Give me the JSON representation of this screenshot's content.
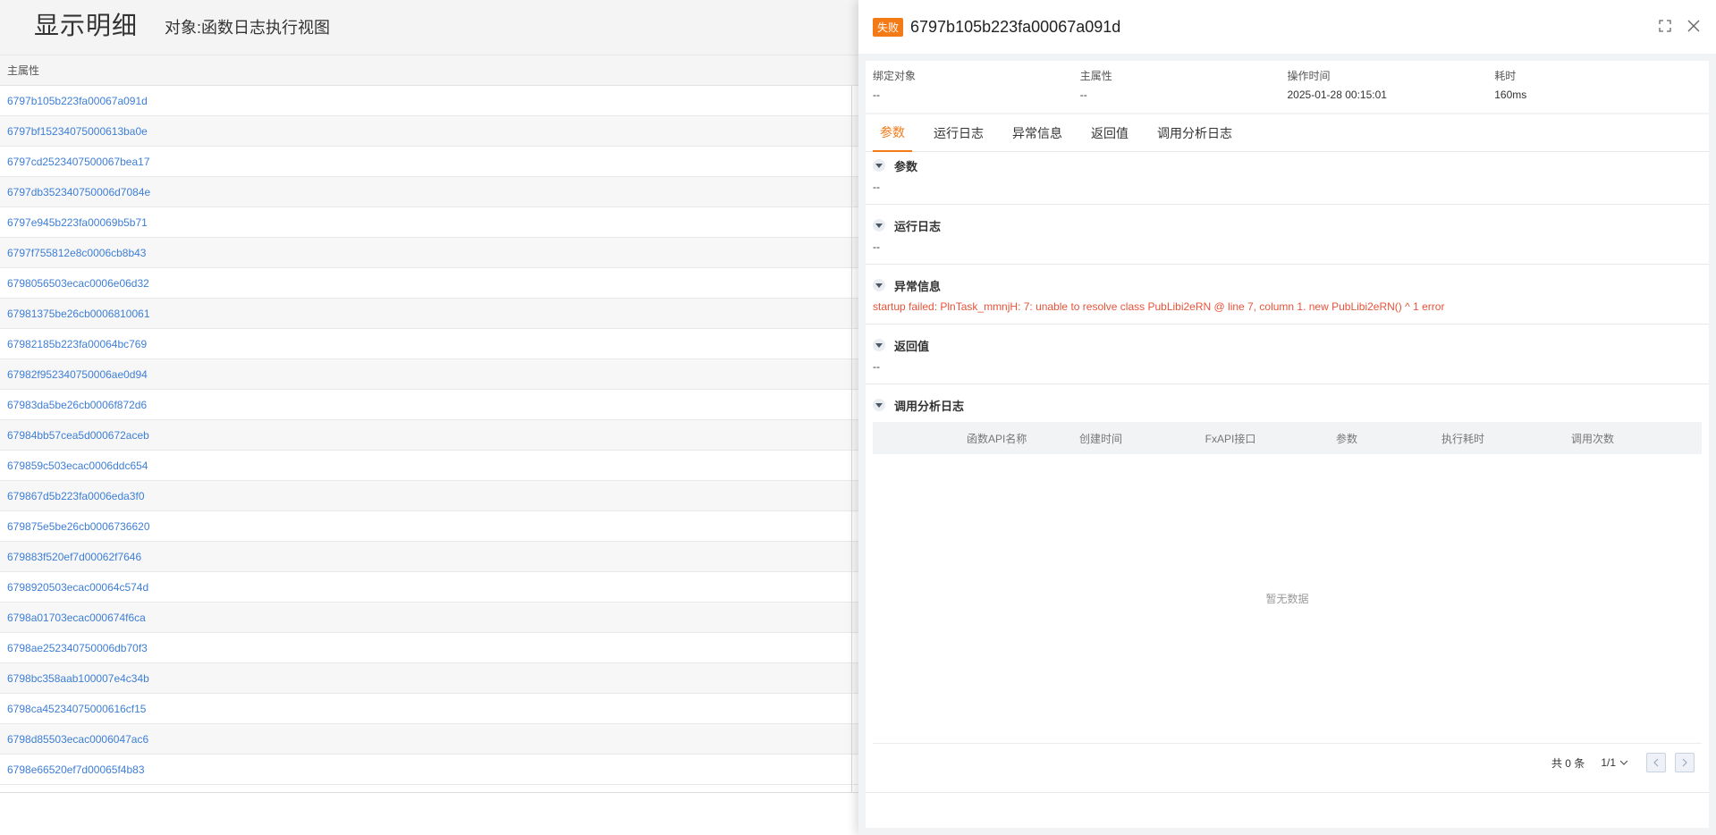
{
  "left": {
    "title": "显示明细",
    "subtitle": "对象:函数日志执行视图",
    "column_header": "主属性",
    "rows": [
      "6797b105b223fa00067a091d",
      "6797bf15234075000613ba0e",
      "6797cd2523407500067bea17",
      "6797db352340750006d7084e",
      "6797e945b223fa00069b5b71",
      "6797f755812e8c0006cb8b43",
      "6798056503ecac0006e06d32",
      "67981375be26cb0006810061",
      "67982185b223fa00064bc769",
      "67982f952340750006ae0d94",
      "67983da5be26cb0006f872d6",
      "67984bb57cea5d000672aceb",
      "679859c503ecac0006ddc654",
      "679867d5b223fa0006eda3f0",
      "679875e5be26cb0006736620",
      "679883f520ef7d00062f7646",
      "6798920503ecac00064c574d",
      "6798a01703ecac000674f6ca",
      "6798ae252340750006db70f3",
      "6798bc358aab100007e4c34b",
      "6798ca45234075000616cf15",
      "6798d85503ecac0006047ac6",
      "6798e66520ef7d00065f4b83"
    ]
  },
  "drawer": {
    "status_badge": "失败",
    "title": "6797b105b223fa00067a091d",
    "info": [
      {
        "label": "绑定对象",
        "value": "--"
      },
      {
        "label": "主属性",
        "value": "--"
      },
      {
        "label": "操作时间",
        "value": "2025-01-28 00:15:01"
      },
      {
        "label": "耗时",
        "value": "160ms"
      }
    ],
    "tabs": [
      "参数",
      "运行日志",
      "异常信息",
      "返回值",
      "调用分析日志"
    ],
    "sections": {
      "params": {
        "title": "参数",
        "body": "--"
      },
      "runlog": {
        "title": "运行日志",
        "body": "--"
      },
      "error": {
        "title": "异常信息",
        "body": "startup failed: PlnTask_mmnjH: 7: unable to resolve class PubLibi2eRN @ line 7, column 1. new PubLibi2eRN() ^ 1 error"
      },
      "retval": {
        "title": "返回值",
        "body": "--"
      },
      "analysis": {
        "title": "调用分析日志"
      }
    },
    "table": {
      "columns": [
        "函数API名称",
        "创建时间",
        "FxAPI接口",
        "参数",
        "执行耗时",
        "调用次数"
      ],
      "empty_text": "暂无数据"
    },
    "pager": {
      "total": "共 0 条",
      "page": "1/1"
    },
    "colors": {
      "accent": "#f47a16",
      "error": "#e8533a",
      "link": "#3d7ed6"
    }
  }
}
